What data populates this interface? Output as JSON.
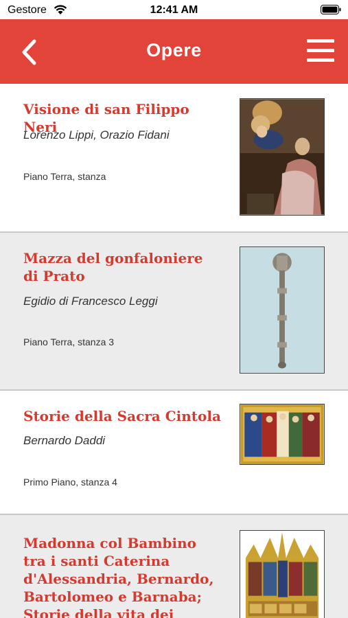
{
  "status_bar": {
    "carrier": "Gestore",
    "time": "12:41 AM"
  },
  "nav": {
    "title": "Opere",
    "back_icon": "chevron-left-icon",
    "menu_icon": "hamburger-menu-icon",
    "color": "#e3443a"
  },
  "items": [
    {
      "title": "Visione di san Filippo Neri",
      "author": "Lorenzo Lippi, Orazio Fidani",
      "location": "Piano Terra, stanza"
    },
    {
      "title": "Mazza del gonfaloniere di Prato",
      "author": "Egidio di Francesco Leggi",
      "location": "Piano Terra, stanza 3"
    },
    {
      "title": "Storie della Sacra Cintola",
      "author": "Bernardo Daddi",
      "location": "Primo Piano, stanza 4"
    },
    {
      "title": "Madonna col Bambino tra i santi Caterina d'Alessandria, Bernardo, Bartolomeo e Barnaba; Storie della vita dei Santi.",
      "author": "",
      "location": ""
    }
  ],
  "colors": {
    "title_red": "#d43b30",
    "row_grey": "#ececec"
  }
}
